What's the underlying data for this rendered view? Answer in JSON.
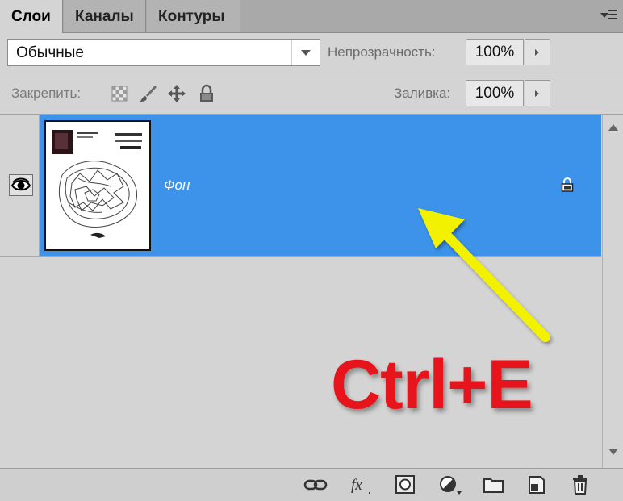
{
  "tabs": [
    {
      "label": "Слои",
      "active": true
    },
    {
      "label": "Каналы",
      "active": false
    },
    {
      "label": "Контуры",
      "active": false
    }
  ],
  "panel_menu_icon": "panel-menu-icon",
  "blend_mode": {
    "value": "Обычные"
  },
  "opacity": {
    "label": "Непрозрачность:",
    "value": "100%"
  },
  "lock": {
    "label": "Закрепить:",
    "icons": [
      "lock-transparent-pixels-icon",
      "lock-image-pixels-icon",
      "lock-position-icon",
      "lock-all-icon"
    ]
  },
  "fill": {
    "label": "Заливка:",
    "value": "100%"
  },
  "layers": [
    {
      "name": "Фон",
      "visible": true,
      "locked": true,
      "selected": true
    }
  ],
  "footer_icons": [
    "link-layers-icon",
    "fx-icon",
    "layer-mask-icon",
    "adjustment-layer-icon",
    "group-folder-icon",
    "new-layer-icon",
    "trash-icon"
  ],
  "annotation": {
    "hotkey": "Ctrl+E",
    "arrow_color": "#f2f200",
    "text_color": "#e8141b"
  },
  "colors": {
    "selection": "#3c93e9",
    "panel": "#d4d4d4"
  }
}
